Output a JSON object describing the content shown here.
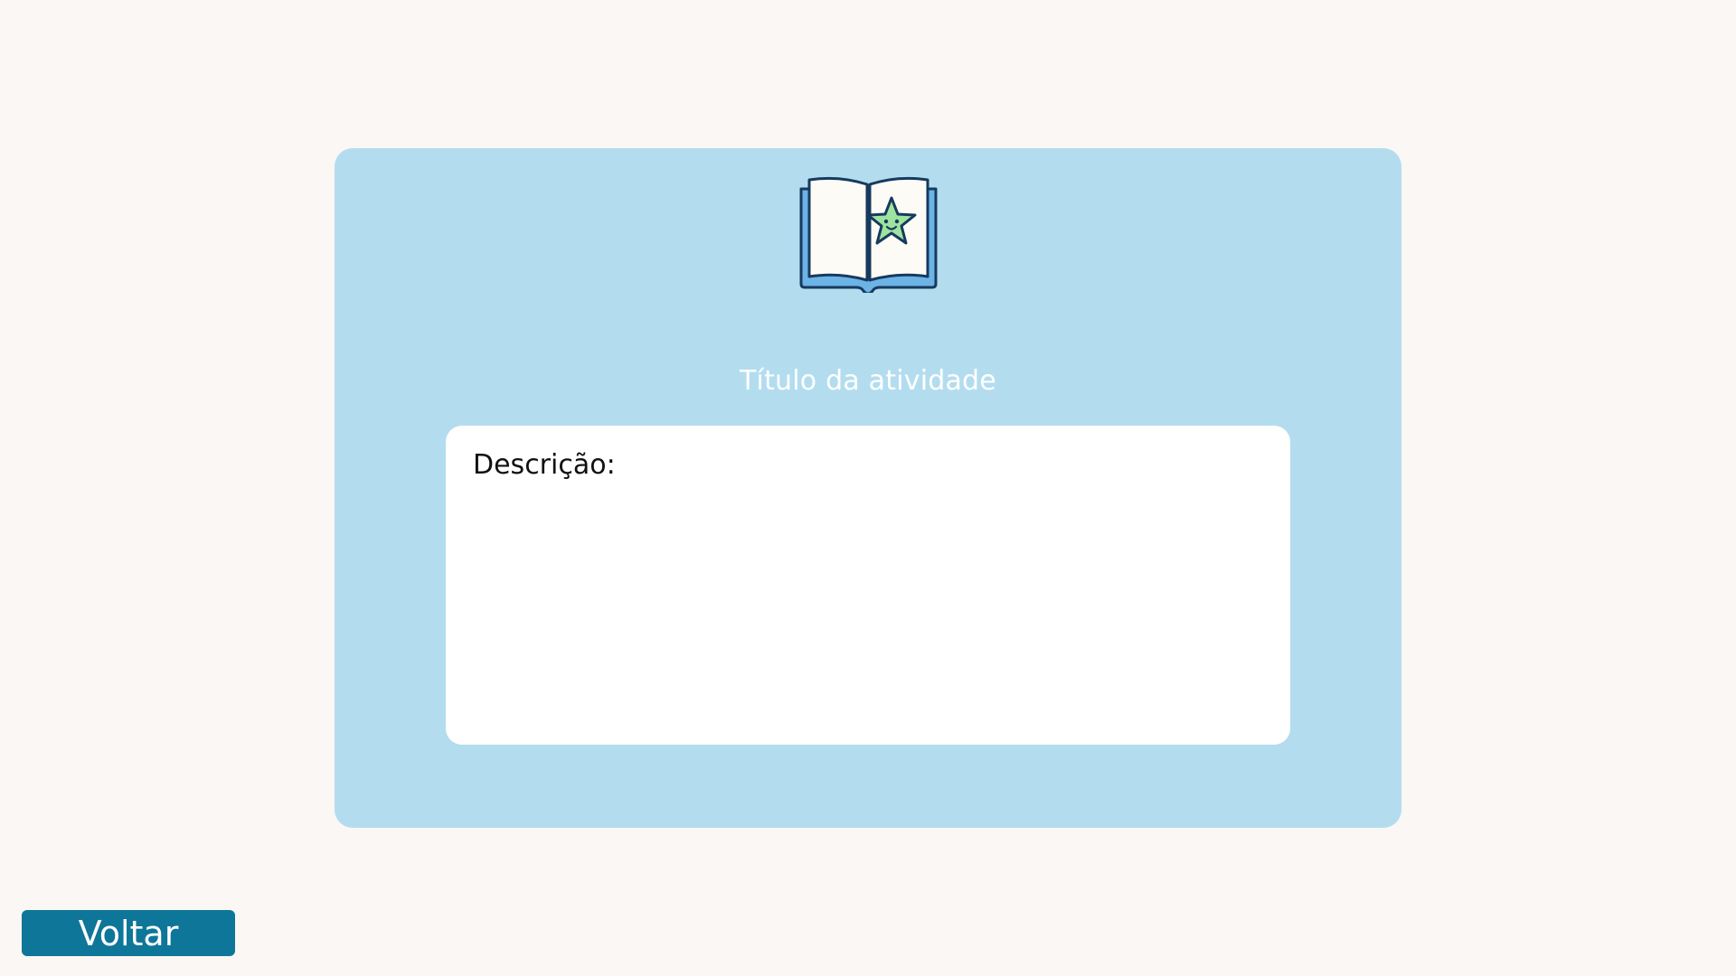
{
  "card": {
    "title": "Título da atividade",
    "icon": "book-star-icon",
    "background_color": "#B3DDEF"
  },
  "description": {
    "label": "Descrição:"
  },
  "footer": {
    "back_label": "Voltar",
    "back_color": "#0E7699"
  }
}
